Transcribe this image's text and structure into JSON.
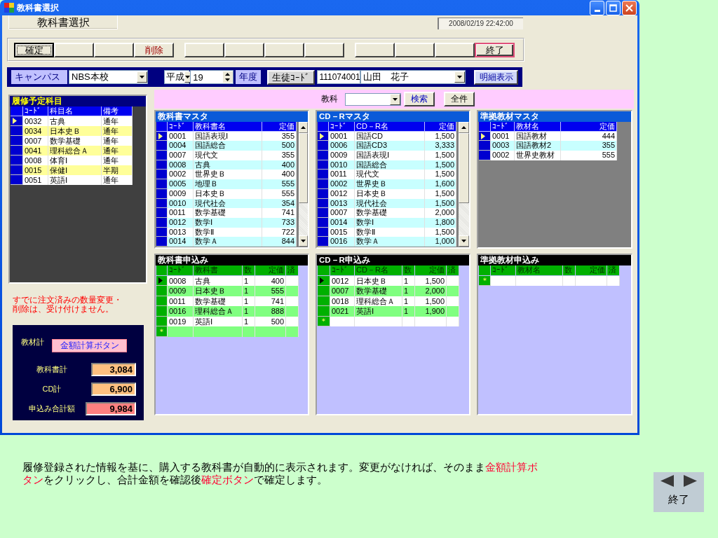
{
  "window": {
    "title": "教科書選択"
  },
  "header": {
    "label": "教科書選択",
    "timestamp": "2008/02/19 22:42:00"
  },
  "toolbar": {
    "groups": [
      [
        {
          "label": "確定",
          "kind": "normal",
          "focused": true,
          "highlighted": false
        },
        {
          "kind": "blank",
          "focused": false,
          "highlighted": false
        },
        {
          "kind": "blank",
          "focused": false,
          "highlighted": false
        },
        {
          "label": "削除",
          "kind": "danger",
          "focused": false,
          "highlighted": false
        }
      ],
      [
        {
          "kind": "blank",
          "focused": false,
          "highlighted": false
        },
        {
          "kind": "blank",
          "focused": false,
          "highlighted": false
        },
        {
          "kind": "blank",
          "focused": false,
          "highlighted": false
        },
        {
          "kind": "blank",
          "focused": false,
          "highlighted": false
        }
      ],
      [
        {
          "kind": "blank",
          "focused": false,
          "highlighted": false
        },
        {
          "kind": "blank",
          "focused": false,
          "highlighted": false
        },
        {
          "kind": "blank",
          "focused": false,
          "highlighted": false
        },
        {
          "label": "終了",
          "kind": "normal",
          "focused": false,
          "highlighted": true
        }
      ]
    ]
  },
  "filter": {
    "campus_label": "キャンパス",
    "campus": "NBS本校",
    "era": "平成",
    "year": "19",
    "year_label": "年度",
    "student_code_button": "生徒ｺｰﾄﾞ",
    "student_code": "111074001",
    "student_name": "山田　花子",
    "detail_button": "明細表示"
  },
  "planned_subjects": {
    "title": "履修予定科目",
    "columns": [
      "ｺｰﾄﾞ",
      "科目名",
      "備考"
    ],
    "rows": [
      {
        "cells": [
          "0032",
          "古典",
          "通年"
        ],
        "current": true
      },
      {
        "cells": [
          "0034",
          "日本史Ｂ",
          "通年"
        ],
        "current": false
      },
      {
        "cells": [
          "0007",
          "数学基礎",
          "通年"
        ],
        "current": false
      },
      {
        "cells": [
          "0041",
          "理科総合Ａ",
          "通年"
        ],
        "current": false
      },
      {
        "cells": [
          "0008",
          "体育Ⅰ",
          "通年"
        ],
        "current": false
      },
      {
        "cells": [
          "0015",
          "保健Ⅰ",
          "半期"
        ],
        "current": false
      },
      {
        "cells": [
          "0051",
          "英語Ⅰ",
          "通年"
        ],
        "current": false
      }
    ]
  },
  "notice": [
    "すでに注文済みの数量変更・",
    "削除は、受け付けません。"
  ],
  "totals": {
    "label": "教材計",
    "calc_button": "金額計算ボタン",
    "rows": [
      {
        "label": "教科書計",
        "value": "3,084",
        "kind": "subtotal"
      },
      {
        "label": "CD計",
        "value": "6,900",
        "kind": "subtotal"
      },
      {
        "label": "申込み合計額",
        "value": "9,984",
        "kind": "total"
      }
    ]
  },
  "search_bar": {
    "label": "教科",
    "search_button": "検索",
    "all_button": "全件"
  },
  "masters": [
    {
      "title": "教科書マスタ",
      "columns": [
        "ｺｰﾄﾞ",
        "教科書名",
        "定価"
      ],
      "scrollbar": true,
      "rows": [
        {
          "cells": [
            "0001",
            "国語表現Ⅰ",
            "355"
          ],
          "current": true
        },
        {
          "cells": [
            "0004",
            "国語総合",
            "500"
          ],
          "current": false
        },
        {
          "cells": [
            "0007",
            "現代文",
            "355"
          ],
          "current": false
        },
        {
          "cells": [
            "0008",
            "古典",
            "400"
          ],
          "current": false
        },
        {
          "cells": [
            "0002",
            "世界史Ｂ",
            "400"
          ],
          "current": false
        },
        {
          "cells": [
            "0005",
            "地理Ｂ",
            "555"
          ],
          "current": false
        },
        {
          "cells": [
            "0009",
            "日本史Ｂ",
            "555"
          ],
          "current": false
        },
        {
          "cells": [
            "0010",
            "現代社会",
            "354"
          ],
          "current": false
        },
        {
          "cells": [
            "0011",
            "数学基礎",
            "741"
          ],
          "current": false
        },
        {
          "cells": [
            "0012",
            "数学Ⅰ",
            "733"
          ],
          "current": false
        },
        {
          "cells": [
            "0013",
            "数学Ⅱ",
            "722"
          ],
          "current": false
        },
        {
          "cells": [
            "0014",
            "数学Ａ",
            "844"
          ],
          "current": false
        }
      ]
    },
    {
      "title": "CD－Rマスタ",
      "columns": [
        "ｺｰﾄﾞ",
        "CD－R名",
        "定価"
      ],
      "scrollbar": true,
      "rows": [
        {
          "cells": [
            "0001",
            "国語CD",
            "1,500"
          ],
          "current": true
        },
        {
          "cells": [
            "0006",
            "国語CD3",
            "3,333"
          ],
          "current": false
        },
        {
          "cells": [
            "0009",
            "国語表現Ⅰ",
            "1,500"
          ],
          "current": false
        },
        {
          "cells": [
            "0010",
            "国語総合",
            "1,500"
          ],
          "current": false
        },
        {
          "cells": [
            "0011",
            "現代文",
            "1,500"
          ],
          "current": false
        },
        {
          "cells": [
            "0002",
            "世界史Ｂ",
            "1,600"
          ],
          "current": false
        },
        {
          "cells": [
            "0012",
            "日本史Ｂ",
            "1,500"
          ],
          "current": false
        },
        {
          "cells": [
            "0013",
            "現代社会",
            "1,500"
          ],
          "current": false
        },
        {
          "cells": [
            "0007",
            "数学基礎",
            "2,000"
          ],
          "current": false
        },
        {
          "cells": [
            "0014",
            "数学Ⅰ",
            "1,800"
          ],
          "current": false
        },
        {
          "cells": [
            "0015",
            "数学Ⅱ",
            "1,500"
          ],
          "current": false
        },
        {
          "cells": [
            "0016",
            "数学Ａ",
            "1,000"
          ],
          "current": false
        }
      ]
    },
    {
      "title": "準拠教材マスタ",
      "columns": [
        "ｺｰﾄﾞ",
        "教材名",
        "定価"
      ],
      "scrollbar": false,
      "rows": [
        {
          "cells": [
            "0001",
            "国語教材",
            "444"
          ],
          "current": true
        },
        {
          "cells": [
            "0003",
            "国語教材2",
            "355"
          ],
          "current": false
        },
        {
          "cells": [
            "0002",
            "世界史教材",
            "555"
          ],
          "current": false
        }
      ]
    }
  ],
  "orders": [
    {
      "title": "教科書申込み",
      "columns": [
        "ｺｰﾄﾞ",
        "教科書",
        "数",
        "定価",
        "済"
      ],
      "new_row_marker": "＊",
      "rows": [
        {
          "cells": [
            "0008",
            "古典",
            "1",
            "400"
          ],
          "current": true
        },
        {
          "cells": [
            "0009",
            "日本史Ｂ",
            "1",
            "555"
          ],
          "current": false
        },
        {
          "cells": [
            "0011",
            "数学基礎",
            "1",
            "741"
          ],
          "current": false
        },
        {
          "cells": [
            "0016",
            "理科総合Ａ",
            "1",
            "888"
          ],
          "current": false
        },
        {
          "cells": [
            "0019",
            "英語Ⅰ",
            "1",
            "500"
          ],
          "current": false
        }
      ]
    },
    {
      "title": "CD－R申込み",
      "columns": [
        "ｺｰﾄﾞ",
        "CD－R名",
        "数",
        "定価",
        "済"
      ],
      "new_row_marker": "＊",
      "rows": [
        {
          "cells": [
            "0012",
            "日本史Ｂ",
            "1",
            "1,500"
          ],
          "current": true
        },
        {
          "cells": [
            "0007",
            "数学基礎",
            "1",
            "2,000"
          ],
          "current": false
        },
        {
          "cells": [
            "0018",
            "理科総合Ａ",
            "1",
            "1,500"
          ],
          "current": false
        },
        {
          "cells": [
            "0021",
            "英語Ⅰ",
            "1",
            "1,900"
          ],
          "current": false
        }
      ]
    },
    {
      "title": "準拠教材申込み",
      "columns": [
        "ｺｰﾄﾞ",
        "教材名",
        "数",
        "定価",
        "済"
      ],
      "new_row_marker": "＊"
    }
  ],
  "caption": {
    "segments": [
      {
        "text": "履修登録された情報を基に、購入する教科書が自動的に表示されます。変更がなければ、そのまま",
        "highlight": false
      },
      {
        "text": "金額計算ボタン",
        "highlight": true
      },
      {
        "text": "をクリックし、合計金額を確認後",
        "highlight": false
      },
      {
        "text": "確定ボタン",
        "highlight": true
      },
      {
        "text": "で確定します。",
        "highlight": false
      }
    ]
  },
  "nav": {
    "exit": "終了"
  }
}
